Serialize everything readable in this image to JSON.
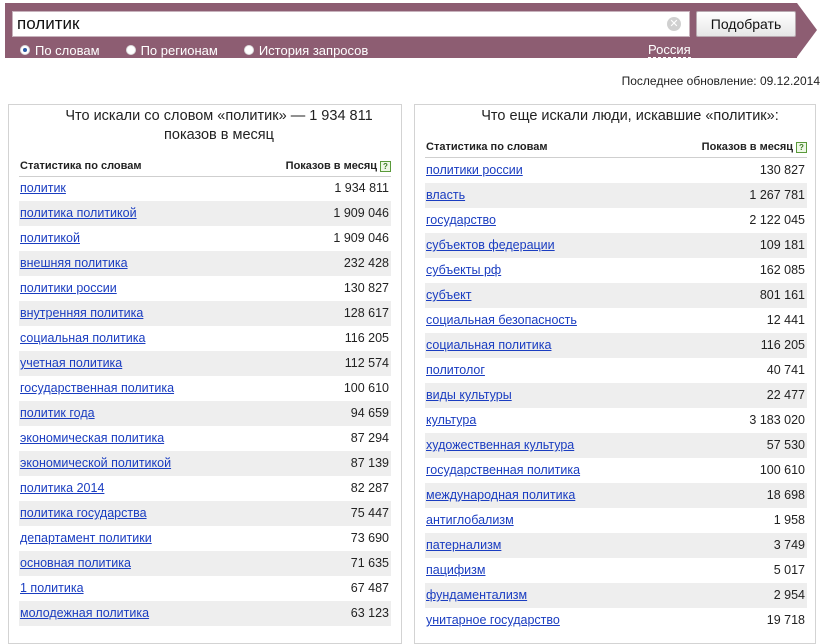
{
  "search": {
    "value": "политик",
    "button_label": "Подобрать",
    "clear_icon": "close-icon",
    "options": [
      {
        "label": "По словам",
        "checked": true
      },
      {
        "label": "По регионам",
        "checked": false
      },
      {
        "label": "История запросов",
        "checked": false
      }
    ],
    "region": "Россия"
  },
  "last_update": "Последнее обновление: 09.12.2014",
  "left": {
    "title": "Что искали со словом «политик» — 1 934 811 показов в месяц",
    "col_word": "Статистика по словам",
    "col_count": "Показов в месяц",
    "help": "?",
    "rows": [
      {
        "word": "политик",
        "count": "1 934 811"
      },
      {
        "word": "политика политикой",
        "count": "1 909 046"
      },
      {
        "word": "политикой",
        "count": "1 909 046"
      },
      {
        "word": "внешняя политика",
        "count": "232 428"
      },
      {
        "word": "политики россии",
        "count": "130 827"
      },
      {
        "word": "внутренняя политика",
        "count": "128 617"
      },
      {
        "word": "социальная политика",
        "count": "116 205"
      },
      {
        "word": "учетная политика",
        "count": "112 574"
      },
      {
        "word": "государственная политика",
        "count": "100 610"
      },
      {
        "word": "политик года",
        "count": "94 659"
      },
      {
        "word": "экономическая политика",
        "count": "87 294"
      },
      {
        "word": "экономической политикой",
        "count": "87 139"
      },
      {
        "word": "политика 2014",
        "count": "82 287"
      },
      {
        "word": "политика государства",
        "count": "75 447"
      },
      {
        "word": "департамент политики",
        "count": "73 690"
      },
      {
        "word": "основная политика",
        "count": "71 635"
      },
      {
        "word": "1 политика",
        "count": "67 487"
      },
      {
        "word": "молодежная политика",
        "count": "63 123"
      }
    ]
  },
  "right": {
    "title": "Что еще искали люди, искавшие «политик»:",
    "col_word": "Статистика по словам",
    "col_count": "Показов в месяц",
    "help": "?",
    "rows": [
      {
        "word": "политики россии",
        "count": "130 827"
      },
      {
        "word": "власть",
        "count": "1 267 781"
      },
      {
        "word": "государство",
        "count": "2 122 045"
      },
      {
        "word": "субъектов федерации",
        "count": "109 181"
      },
      {
        "word": "субъекты рф",
        "count": "162 085"
      },
      {
        "word": "субъект",
        "count": "801 161"
      },
      {
        "word": "социальная безопасность",
        "count": "12 441"
      },
      {
        "word": "социальная политика",
        "count": "116 205"
      },
      {
        "word": "политолог",
        "count": "40 741"
      },
      {
        "word": "виды культуры",
        "count": "22 477"
      },
      {
        "word": "культура",
        "count": "3 183 020"
      },
      {
        "word": "художественная культура",
        "count": "57 530"
      },
      {
        "word": "государственная политика",
        "count": "100 610"
      },
      {
        "word": "международная политика",
        "count": "18 698"
      },
      {
        "word": "антиглобализм",
        "count": "1 958"
      },
      {
        "word": "патернализм",
        "count": "3 749"
      },
      {
        "word": "пацифизм",
        "count": "5 017"
      },
      {
        "word": "фундаментализм",
        "count": "2 954"
      },
      {
        "word": "унитарное государство",
        "count": "19 718"
      }
    ]
  }
}
